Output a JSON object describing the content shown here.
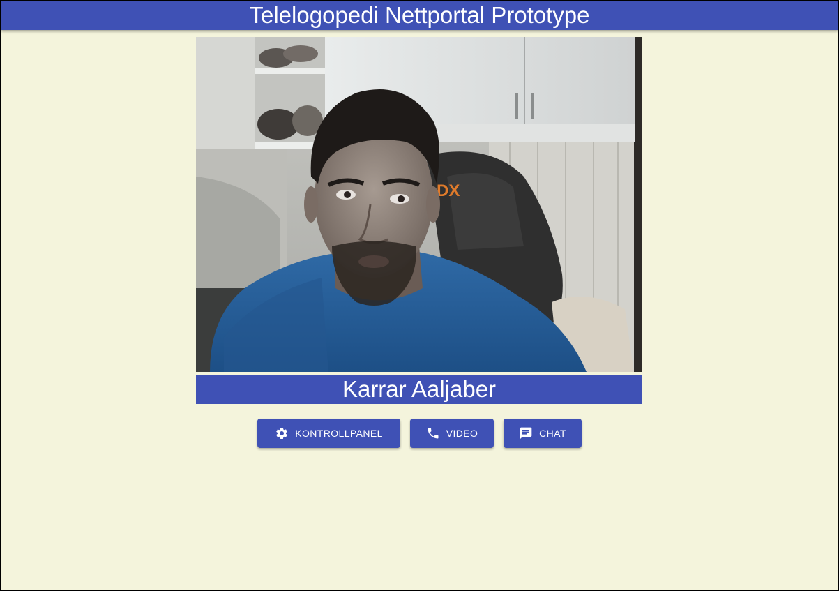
{
  "header": {
    "title": "Telelogopedi Nettportal Prototype"
  },
  "video": {
    "participant_name": "Karrar Aaljaber"
  },
  "actions": {
    "kontrollpanel_label": "KONTROLLPANEL",
    "video_label": "VIDEO",
    "chat_label": "CHAT"
  },
  "icons": {
    "kontrollpanel": "gear-icon",
    "video": "phone-icon",
    "chat": "chat-icon"
  },
  "colors": {
    "primary": "#3f51b5",
    "background": "#f4f4dc",
    "text_on_primary": "#ffffff"
  }
}
